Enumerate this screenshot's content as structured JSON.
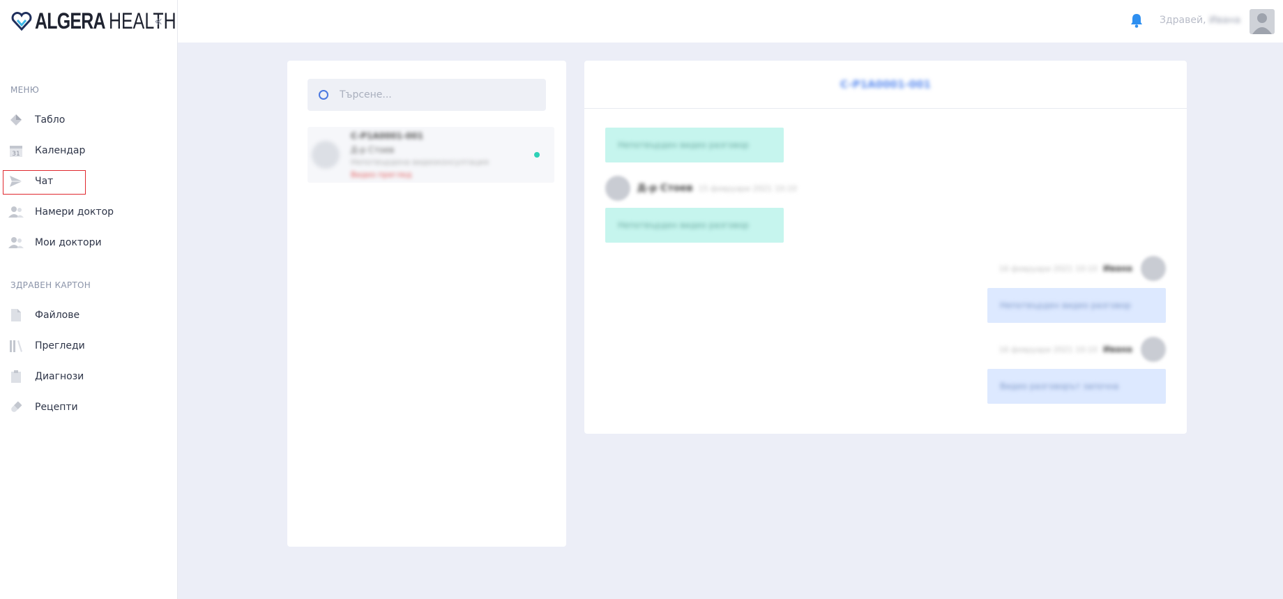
{
  "logo": {
    "part1": "ALGERA",
    "part2": "HEALTH"
  },
  "collapse_glyph": "«",
  "sidebar": {
    "menu_title": "МЕНЮ",
    "menu_items": [
      {
        "label": "Табло",
        "icon": "diamond-icon"
      },
      {
        "label": "Календар",
        "icon": "calendar-icon",
        "icon_text": "31"
      },
      {
        "label": "Чат",
        "icon": "paper-plane-icon"
      },
      {
        "label": "Намери доктор",
        "icon": "users-icon"
      },
      {
        "label": "Мои доктори",
        "icon": "users-icon"
      }
    ],
    "record_title": "ЗДРАВЕН КАРТОН",
    "record_items": [
      {
        "label": "Файлове",
        "icon": "file-icon"
      },
      {
        "label": "Прегледи",
        "icon": "books-icon"
      },
      {
        "label": "Диагнози",
        "icon": "clipboard-icon"
      },
      {
        "label": "Рецепти",
        "icon": "pill-icon"
      }
    ]
  },
  "header": {
    "greeting": "Здравей,",
    "user_name": "Ивана"
  },
  "search": {
    "placeholder": "Търсене..."
  },
  "conversation": {
    "code": "C-P1A0001-001",
    "doctor": "Д-р Стоев",
    "preview": "Непотвърдена видеоконсултация",
    "status": "Видео преглед"
  },
  "chat": {
    "title": "C-P1A0001-001",
    "messages": [
      {
        "text": "Непотвърден видео разговор"
      },
      {
        "author": "Д-р Стоев",
        "time": "15 февруари 2021 10:10"
      },
      {
        "text": "Непотвърден видео разговор"
      },
      {
        "author": "Ивана",
        "time": "16 февруари 2021 10:10"
      },
      {
        "text": "Непотвърден видео разговор"
      },
      {
        "author": "Ивана",
        "time": "16 февруари 2021 10:10"
      },
      {
        "text": "Видео разговорът започна"
      }
    ]
  },
  "colors": {
    "accent": "#4a78e0",
    "incoming": "#c6f5ee",
    "outgoing": "#dde9ff",
    "highlight": "#e0282e"
  }
}
